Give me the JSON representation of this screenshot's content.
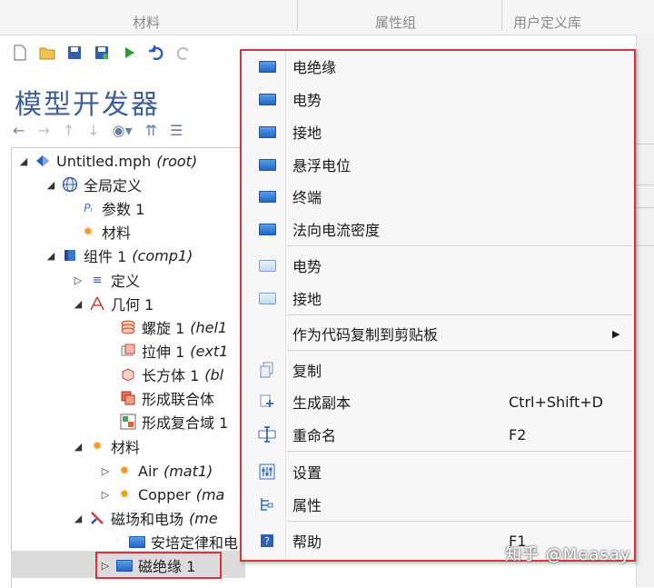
{
  "ribbon": {
    "labels": [
      "材料",
      "属性组",
      "用户定义库"
    ]
  },
  "builder": {
    "title": "模型开发器"
  },
  "tree": [
    {
      "label": "Untitled.mph",
      "suffix": "(root)",
      "icon": "root-diamond-icon"
    },
    {
      "label": "全局定义",
      "suffix": "",
      "icon": "globe-icon"
    },
    {
      "label": "参数 1",
      "suffix": "",
      "icon": "parameters-icon"
    },
    {
      "label": "材料",
      "suffix": "",
      "icon": "materials-icon"
    },
    {
      "label": "组件 1",
      "suffix": "(comp1)",
      "icon": "component-icon"
    },
    {
      "label": "定义",
      "suffix": "",
      "icon": "definitions-icon"
    },
    {
      "label": "几何 1",
      "suffix": "",
      "icon": "geometry-icon"
    },
    {
      "label": "螺旋 1",
      "suffix": "(hel1",
      "icon": "helix-icon"
    },
    {
      "label": "拉伸 1",
      "suffix": "(ext1",
      "icon": "extrude-icon"
    },
    {
      "label": "长方体 1",
      "suffix": "(bl",
      "icon": "block-icon"
    },
    {
      "label": "形成联合体",
      "suffix": "",
      "icon": "union-icon"
    },
    {
      "label": "形成复合域 1",
      "suffix": "",
      "icon": "assembly-icon"
    },
    {
      "label": "材料",
      "suffix": "",
      "icon": "materials-icon"
    },
    {
      "label": "Air",
      "suffix": "(mat1)",
      "icon": "material-icon"
    },
    {
      "label": "Copper",
      "suffix": "(ma",
      "icon": "material-icon"
    },
    {
      "label": "磁场和电场",
      "suffix": "(me",
      "icon": "mef-physics-icon"
    },
    {
      "label": "安培定律和电",
      "suffix": "",
      "icon": "boundary-blue-icon"
    },
    {
      "label": "磁绝缘 1",
      "suffix": "",
      "icon": "boundary-blue-icon"
    }
  ],
  "menu": {
    "items": [
      {
        "label": "电绝缘",
        "icon": "boundary-blue-icon",
        "shortcut": ""
      },
      {
        "label": "电势",
        "icon": "boundary-blue-icon",
        "shortcut": ""
      },
      {
        "label": "接地",
        "icon": "boundary-blue-icon",
        "shortcut": ""
      },
      {
        "label": "悬浮电位",
        "icon": "boundary-blue-icon",
        "shortcut": ""
      },
      {
        "label": "终端",
        "icon": "boundary-blue-icon",
        "shortcut": ""
      },
      {
        "label": "法向电流密度",
        "icon": "boundary-blue-icon",
        "shortcut": ""
      },
      {
        "label": "电势",
        "icon": "edge-outline-icon",
        "shortcut": ""
      },
      {
        "label": "接地",
        "icon": "edge-outline-icon",
        "shortcut": ""
      },
      {
        "label": "作为代码复制到剪贴板",
        "icon": "",
        "shortcut": ""
      },
      {
        "label": "复制",
        "icon": "copy-icon",
        "shortcut": ""
      },
      {
        "label": "生成副本",
        "icon": "duplicate-icon",
        "shortcut": "Ctrl+Shift+D"
      },
      {
        "label": "重命名",
        "icon": "rename-icon",
        "shortcut": "F2"
      },
      {
        "label": "设置",
        "icon": "settings-icon",
        "shortcut": ""
      },
      {
        "label": "属性",
        "icon": "properties-icon",
        "shortcut": ""
      },
      {
        "label": "帮助",
        "icon": "help-icon",
        "shortcut": "F1"
      }
    ]
  },
  "watermark": "知乎 @Measay",
  "colors": {
    "accent_red": "#d9343a",
    "title_blue": "#3f5f9a",
    "menu_bg": "#f7f7f7"
  }
}
